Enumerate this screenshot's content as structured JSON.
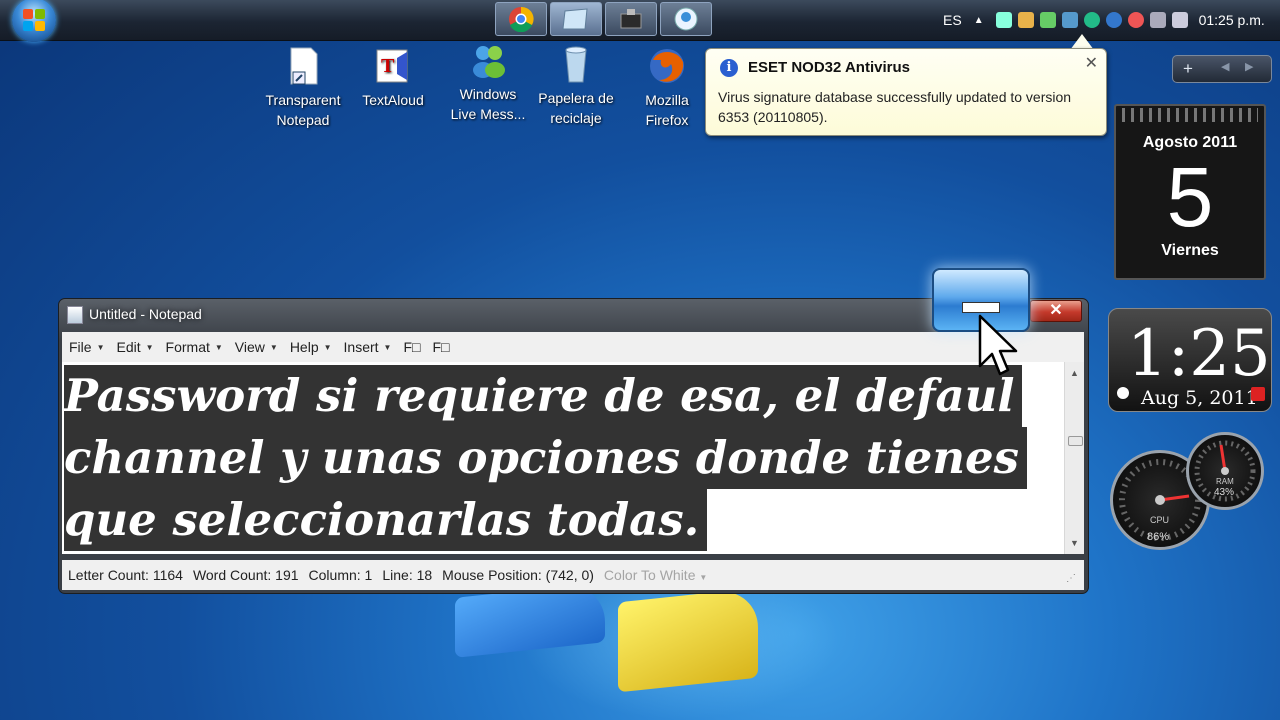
{
  "taskbar": {
    "language": "ES",
    "clock": "01:25 p.m.",
    "buttons": [
      "chrome-icon",
      "notepad-icon",
      "media-icon",
      "messenger-icon"
    ]
  },
  "desktop_icons": [
    {
      "label": "Transparent Notepad",
      "icon": "notepad-shortcut-icon"
    },
    {
      "label": "TextAloud",
      "icon": "textaloud-icon"
    },
    {
      "label": "Windows Live Mess...",
      "icon": "messenger-icon"
    },
    {
      "label": "Papelera de reciclaje",
      "icon": "recycle-bin-icon"
    },
    {
      "label": "Mozilla Firefox",
      "icon": "firefox-icon"
    }
  ],
  "notification": {
    "title": "ESET NOD32 Antivirus",
    "message": "Virus signature database successfully updated to version 6353 (20110805)."
  },
  "gadgets": {
    "calendar": {
      "month": "Agosto 2011",
      "day": "5",
      "weekday": "Viernes"
    },
    "clock": {
      "time": "1:25",
      "date": "Aug 5, 2011"
    },
    "gauges": {
      "cpu": "86%",
      "ram": "43%",
      "cpu_label": "CPU",
      "ram_label": "RAM"
    }
  },
  "notepad": {
    "title": "Untitled - Notepad",
    "menu": [
      "File",
      "Edit",
      "Format",
      "View",
      "Help",
      "Insert",
      "F□",
      "F□"
    ],
    "lines": [
      "Password si requiere de esa, el defaul",
      "channel y unas opciones donde tienes",
      "que seleccionarlas todas."
    ],
    "status": {
      "letter_count": "Letter Count: 1164",
      "word_count": "Word Count: 191",
      "column": "Column: 1",
      "line": "Line: 18",
      "mouse": "Mouse Position: (742, 0)",
      "color": "Color To White"
    },
    "close_glyph": "✕"
  },
  "colors": {
    "selection_bg": "#333333",
    "balloon_bg": "#fdfbd8",
    "close_red": "#c4392b"
  }
}
